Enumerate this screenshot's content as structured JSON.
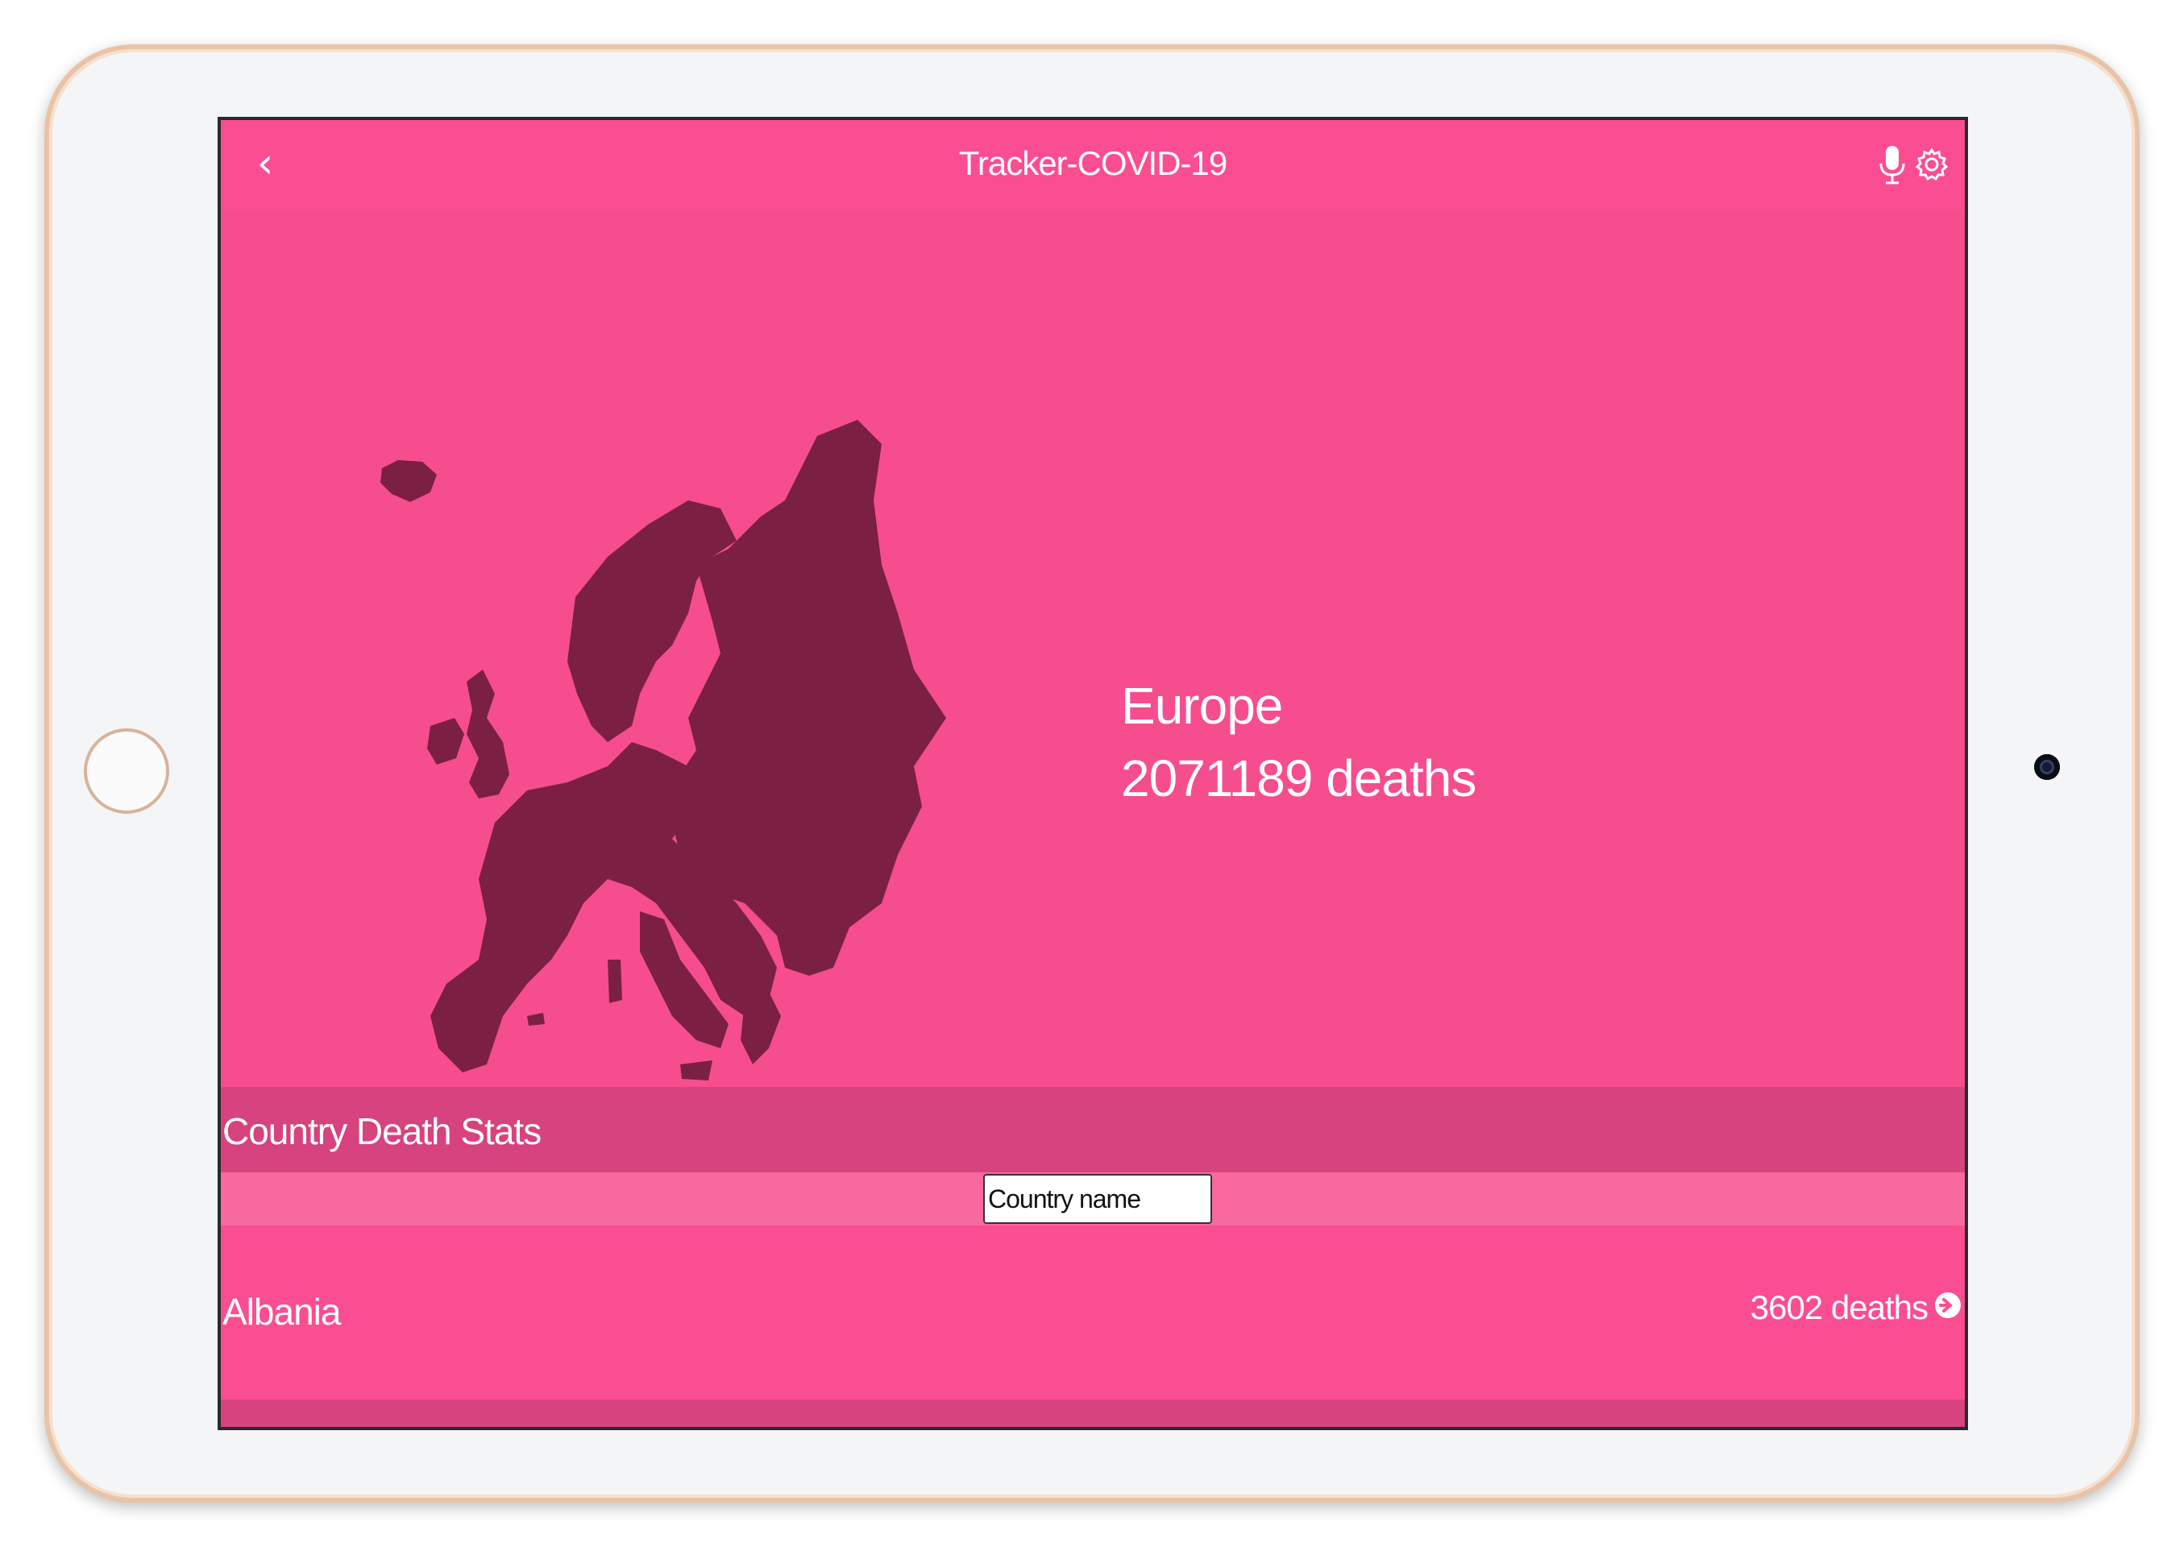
{
  "nav": {
    "title": "Tracker-COVID-19",
    "back_icon": "chevron-left-icon",
    "mic_icon": "microphone-icon",
    "settings_icon": "gear-icon"
  },
  "region": {
    "name": "Europe",
    "deaths_text": "2071189 deaths",
    "map_icon": "europe-map"
  },
  "country_section": {
    "title": "Country Death Stats",
    "search_placeholder": "Country name"
  },
  "countries": [
    {
      "name": "Albania",
      "deaths_text": "3602 deaths",
      "arrow_icon": "arrow-right-circle-icon"
    }
  ],
  "colors": {
    "background": "#f64d8f",
    "nav_background": "#fb4d91",
    "section_header": "#d6437e",
    "search_bar": "#f8699f",
    "map_fill": "#7b2042",
    "text": "#ffffff"
  }
}
